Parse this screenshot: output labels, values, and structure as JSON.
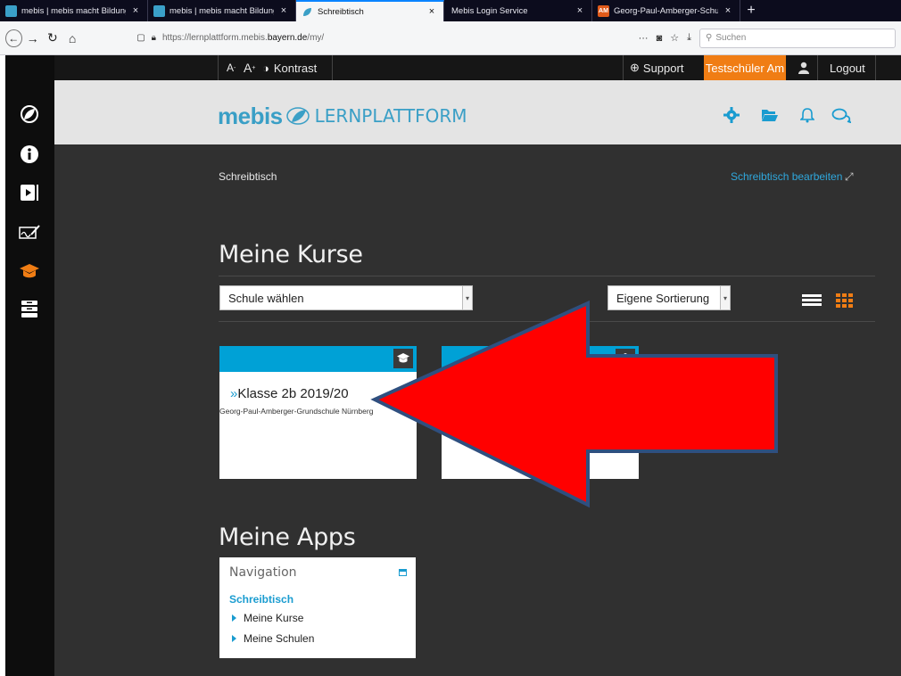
{
  "browser": {
    "tabs": [
      {
        "title": "mebis | mebis macht Bildung di",
        "favicon": "mebis-icon",
        "close": "×",
        "active": false
      },
      {
        "title": "mebis | mebis macht Bildung di",
        "favicon": "mebis-icon",
        "close": "×",
        "active": false
      },
      {
        "title": "Schreibtisch",
        "favicon": "mebis-leaf-icon",
        "close": "×",
        "active": true
      },
      {
        "title": "Mebis Login Service",
        "favicon": "",
        "close": "×",
        "active": false
      },
      {
        "title": "Georg-Paul-Amberger-Schule",
        "favicon": "school-icon",
        "favicon_text": "AM",
        "close": "×",
        "active": false
      }
    ],
    "new_tab": "+",
    "url_prefix": "https://lernplattform.mebis.",
    "url_domain": "bayern.de",
    "url_suffix": "/my/",
    "search_placeholder": "Suchen",
    "page_actions": "···"
  },
  "topbar": {
    "font_smaller": "A",
    "font_larger": "A",
    "contrast_label": "Kontrast",
    "support_label": "Support",
    "user_label": "Testschüler Am",
    "logout_label": "Logout"
  },
  "header": {
    "brand": "mebis",
    "brand_suffix": "LERNPLATTFORM"
  },
  "main": {
    "breadcrumb": "Schreibtisch",
    "edit_link": "Schreibtisch bearbeiten",
    "courses_title": "Meine Kurse",
    "school_select": "Schule wählen",
    "sort_select": "Eigene Sortierung",
    "cards": [
      {
        "title": "Klasse 2b 2019/20",
        "chevron": "»",
        "subtitle": "Georg-Paul-Amberger-Grundschule Nürnberg"
      },
      {
        "title": "",
        "chevron": "",
        "subtitle": ""
      }
    ],
    "apps_title": "Meine Apps",
    "nav_block": {
      "title": "Navigation",
      "home": "Schreibtisch",
      "items": [
        "Meine Kurse",
        "Meine Schulen"
      ]
    }
  },
  "colors": {
    "accent_blue": "#1a9cd0",
    "orange": "#f07d14",
    "card_band": "#00a1d6",
    "overlay_arrow_fill": "#ff0000",
    "overlay_arrow_stroke": "#2f4f7f"
  }
}
